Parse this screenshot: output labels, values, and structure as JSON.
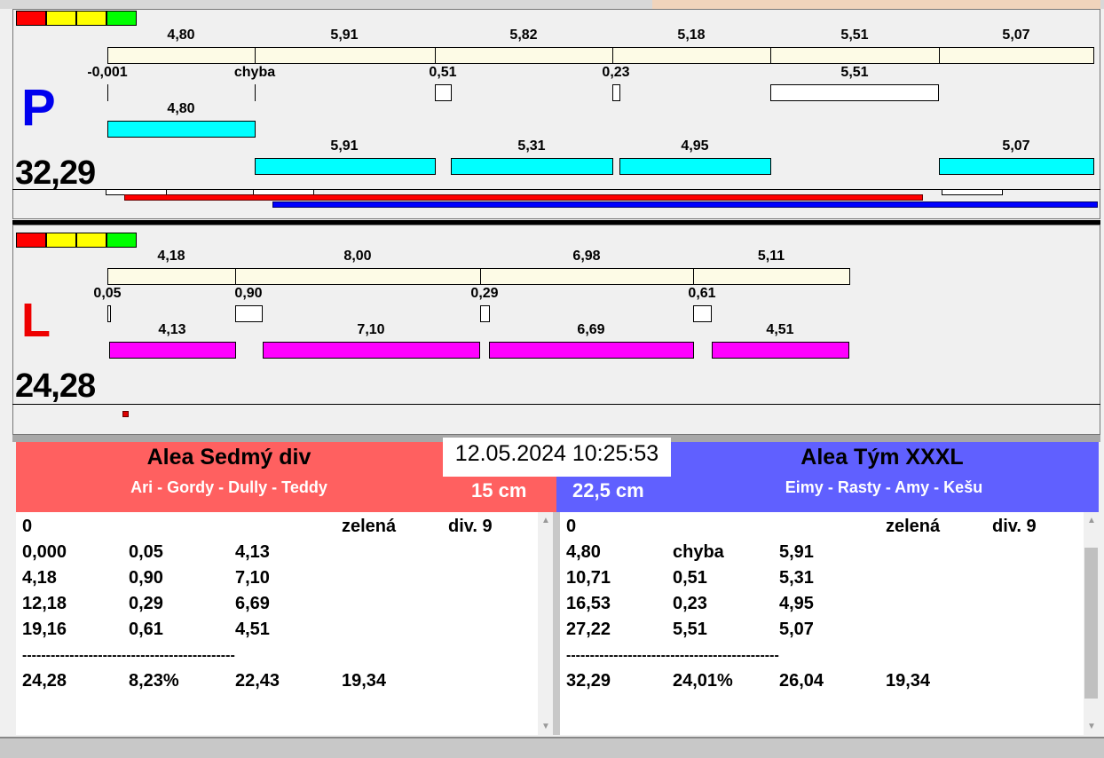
{
  "colors": {
    "legend": [
      "#ff0000",
      "#ffff00",
      "#ffff00",
      "#00ff00"
    ],
    "cyan": "#00ffff",
    "magenta": "#ff00ff",
    "red_team": "#ff6060",
    "blue_team": "#6060ff"
  },
  "p": {
    "letter": "P",
    "total": "32,29",
    "top": [
      "4,80",
      "5,91",
      "5,82",
      "5,18",
      "5,51",
      "5,07"
    ],
    "mid": [
      "-0,001",
      "chyba",
      "0,51",
      "0,23",
      "5,51"
    ],
    "c1": [
      "4,80"
    ],
    "c2": [
      "5,91",
      "5,31",
      "4,95",
      "5,07"
    ]
  },
  "l": {
    "letter": "L",
    "total": "24,28",
    "top": [
      "4,18",
      "8,00",
      "6,98",
      "5,11"
    ],
    "mid": [
      "0,05",
      "0,90",
      "0,29",
      "0,61"
    ],
    "m": [
      "4,13",
      "7,10",
      "6,69",
      "4,51"
    ]
  },
  "datetime": "12.05.2024 10:25:53",
  "left_team": {
    "name": "Alea Sedmý div",
    "members": "Ari - Gordy - Dully - Teddy",
    "size": "15 cm",
    "rows": [
      [
        "0",
        "",
        "",
        "zelená",
        "div. 9"
      ],
      [
        "0,000",
        "0,05",
        "4,13",
        "",
        ""
      ],
      [
        "4,18",
        "0,90",
        "7,10",
        "",
        ""
      ],
      [
        "12,18",
        "0,29",
        "6,69",
        "",
        ""
      ],
      [
        "19,16",
        "0,61",
        "4,51",
        "",
        ""
      ],
      [
        "---------------------------------------------",
        "",
        "",
        "",
        ""
      ],
      [
        "24,28",
        "8,23%",
        "22,43",
        "19,34",
        ""
      ]
    ]
  },
  "right_team": {
    "name": "Alea Tým XXXL",
    "members": "Eimy - Rasty - Amy - Kešu",
    "size": "22,5 cm",
    "rows": [
      [
        "0",
        "",
        "",
        "zelená",
        "div. 9"
      ],
      [
        "4,80",
        "chyba",
        "5,91",
        "",
        ""
      ],
      [
        "10,71",
        "0,51",
        "5,31",
        "",
        ""
      ],
      [
        "16,53",
        "0,23",
        "4,95",
        "",
        ""
      ],
      [
        "27,22",
        "5,51",
        "5,07",
        "",
        ""
      ],
      [
        "---------------------------------------------",
        "",
        "",
        "",
        ""
      ],
      [
        "32,29",
        "24,01%",
        "26,04",
        "19,34",
        ""
      ]
    ]
  }
}
